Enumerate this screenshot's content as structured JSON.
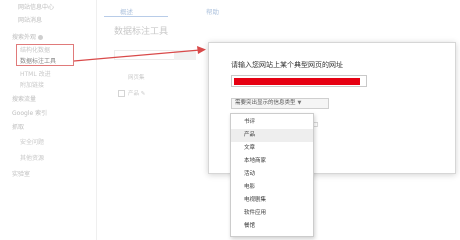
{
  "sidebar": {
    "items": [
      {
        "label": "网站信息中心"
      },
      {
        "label": "网站消息"
      },
      {
        "label": "搜索外观"
      },
      {
        "label": "结构化数据"
      },
      {
        "label": "数据标注工具"
      },
      {
        "label": "HTML 改进"
      },
      {
        "label": "附加链接"
      },
      {
        "label": "搜索流量"
      },
      {
        "label": "Google 索引"
      },
      {
        "label": "抓取"
      },
      {
        "label": "安全问题"
      },
      {
        "label": "其他资源"
      },
      {
        "label": "实验室"
      }
    ]
  },
  "main": {
    "tabs": [
      {
        "label": "概述"
      },
      {
        "label": "帮助"
      }
    ],
    "tool_title": "数据标注工具",
    "column_header": "网页集",
    "row_label": "产品"
  },
  "dialog": {
    "title": "请输入您网站上某个典型网页的网址",
    "type_select_label": "需要突出显示的信息类型",
    "url_value_redacted": true,
    "options": [
      "书评",
      "产品",
      "文章",
      "本地商家",
      "活动",
      "电影",
      "电视剧集",
      "软件应用",
      "餐馆"
    ],
    "highlighted_option": "产品"
  },
  "colors": {
    "annotation_red": "#e60012",
    "arrow_red": "#d94a4a"
  }
}
